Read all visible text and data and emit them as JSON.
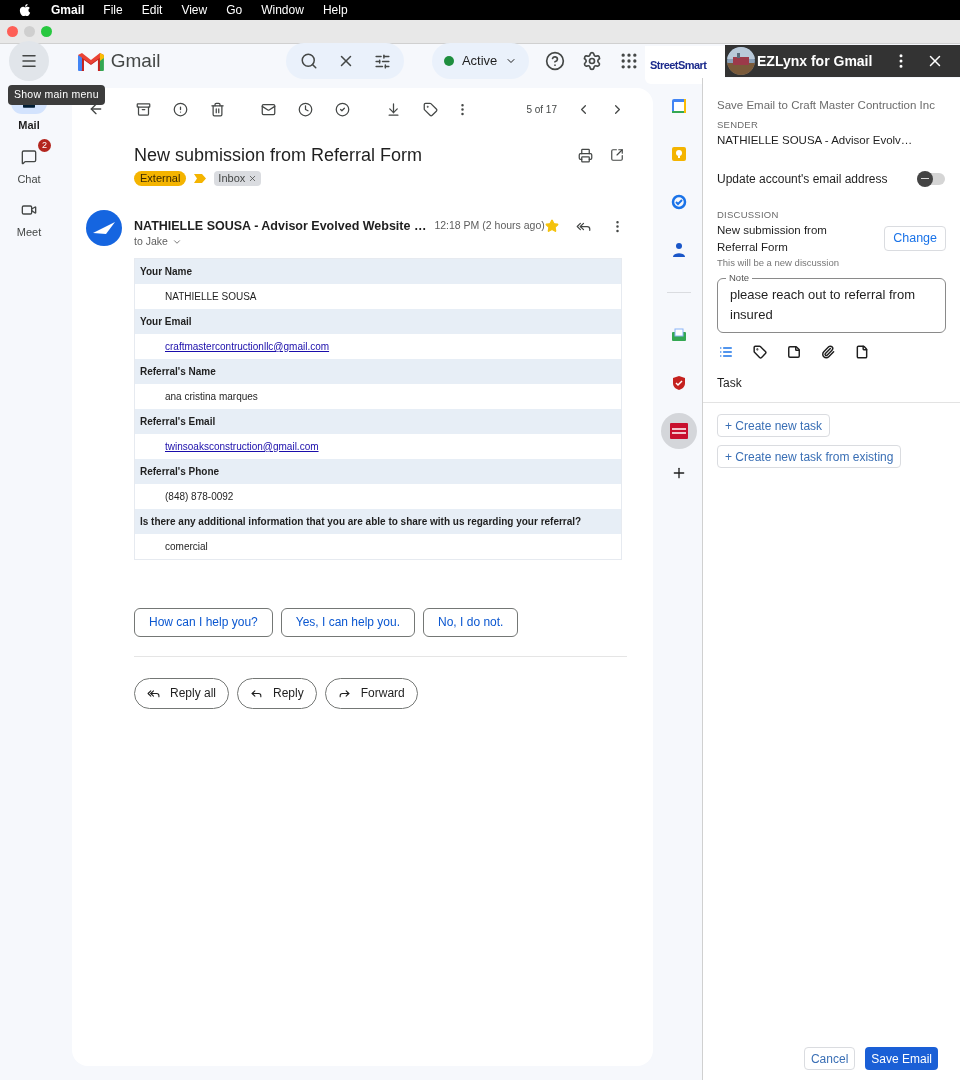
{
  "menu_bar": {
    "app_name": "Gmail",
    "menus": [
      "File",
      "Edit",
      "View",
      "Go",
      "Window",
      "Help"
    ]
  },
  "gmail": {
    "logo_text": "Gmail",
    "status": "Active",
    "tooltip": "Show main menu",
    "pager": "5 of 17",
    "nav": [
      {
        "label": "Mail",
        "kind": "mail",
        "selected": true
      },
      {
        "label": "Chat",
        "kind": "chat",
        "selected": false,
        "badge": "2"
      },
      {
        "label": "Meet",
        "kind": "meet",
        "selected": false
      }
    ]
  },
  "email": {
    "subject": "New submission from Referral Form",
    "labels": [
      {
        "text": "External",
        "kind": "external"
      },
      {
        "text": "Inbox",
        "kind": "inbox"
      }
    ],
    "sender": "NATHIELLE SOUSA - Advisor Evolved Website …",
    "time": "12:18 PM (2 hours ago)",
    "recipient": "to Jake",
    "starred": true,
    "fields": [
      {
        "label": "Your Name",
        "value": "NATHIELLE SOUSA",
        "kind": "text"
      },
      {
        "label": "Your Email",
        "value": "craftmastercontructionllc@gmail.com",
        "kind": "link"
      },
      {
        "label": "Referral's Name",
        "value": "ana cristina marques",
        "kind": "text"
      },
      {
        "label": "Referral's Email",
        "value": "twinsoaksconstruction@gmail.com",
        "kind": "link"
      },
      {
        "label": "Referral's Phone",
        "value": "(848) 878-0092",
        "kind": "text"
      },
      {
        "label": "Is there any additional information that you are able to share with us regarding your referral?",
        "value": "comercial",
        "kind": "text"
      }
    ],
    "smart_replies": [
      "How can I help you?",
      "Yes, I can help you.",
      "No, I do not."
    ],
    "actions": [
      {
        "label": "Reply all",
        "kind": "reply_all"
      },
      {
        "label": "Reply",
        "kind": "reply"
      },
      {
        "label": "Forward",
        "kind": "forward"
      }
    ]
  },
  "side_apps": [
    {
      "kind": "calendar",
      "selected": false
    },
    {
      "kind": "keep",
      "selected": false
    },
    {
      "kind": "tasks",
      "selected": false
    },
    {
      "kind": "contacts",
      "selected": false
    },
    {
      "kind": "mail_addon",
      "selected": false
    },
    {
      "kind": "shield",
      "selected": false
    },
    {
      "kind": "ezlynx",
      "selected": true
    }
  ],
  "panel": {
    "brand": "StreetSmart",
    "title": "EZLynx for Gmail",
    "save_to": "Save Email to Craft Master Contruction Inc",
    "sender_label": "SENDER",
    "sender": "NATHIELLE SOUSA - Advisor Evolv…",
    "update_label": "Update account's email address",
    "update_on": false,
    "discussion_label": "DISCUSSION",
    "discussion": "New submission from Referral Form",
    "change": "Change",
    "discussion_hint": "This will be a new discussion",
    "note_label": "Note",
    "note": "please reach out to referral from insured",
    "tabs": [
      {
        "kind": "list",
        "selected": true
      },
      {
        "kind": "label",
        "selected": false
      },
      {
        "kind": "note",
        "selected": false
      },
      {
        "kind": "attachment",
        "selected": false
      },
      {
        "kind": "document",
        "selected": false
      }
    ],
    "section": "Task",
    "task_buttons": [
      "+ Create new task",
      "+ Create new task from existing"
    ],
    "cancel": "Cancel",
    "save": "Save Email"
  }
}
